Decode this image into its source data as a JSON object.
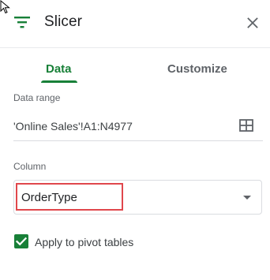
{
  "panel": {
    "title": "Slicer"
  },
  "tabs": [
    {
      "label": "Data",
      "active": true
    },
    {
      "label": "Customize",
      "active": false
    }
  ],
  "data_range": {
    "label": "Data range",
    "value": "'Online Sales'!A1:N4977"
  },
  "column": {
    "label": "Column",
    "selected": "OrderType"
  },
  "pivot_option": {
    "label": "Apply to pivot tables",
    "checked": true
  },
  "colors": {
    "accent": "#188038",
    "highlight": "#e0474c"
  },
  "icons": {
    "header": "filter-list-icon",
    "close": "close-icon",
    "range": "grid-select-icon",
    "dropdown": "caret-down-icon",
    "checkbox": "checkmark-icon"
  }
}
